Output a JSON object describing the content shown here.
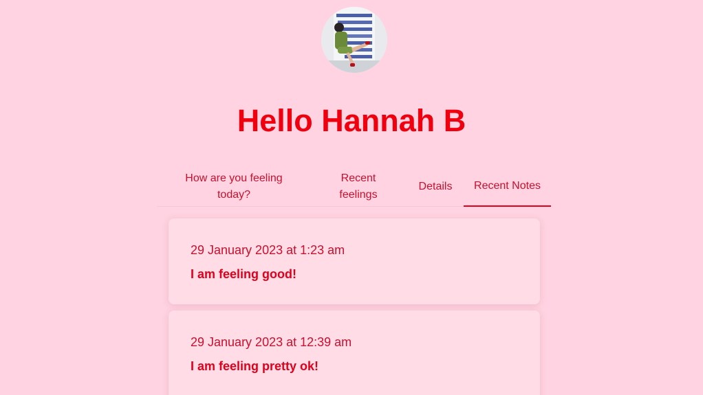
{
  "profile": {
    "avatar_alt": "Profile photo"
  },
  "header": {
    "title": "Hello Hannah B"
  },
  "tabs": [
    {
      "label": "How are you feeling today?"
    },
    {
      "label": "Recent feelings"
    },
    {
      "label": "Details"
    },
    {
      "label": "Recent Notes",
      "active": true
    }
  ],
  "notes": [
    {
      "date": "29 January 2023 at 1:23 am",
      "text": "I am feeling good!"
    },
    {
      "date": "29 January 2023 at 12:39 am",
      "text": "I am feeling pretty ok!"
    }
  ],
  "colors": {
    "background": "#ffd3e1",
    "accent": "#f0000e",
    "text": "#c8102e",
    "card": "#ffdce6"
  }
}
